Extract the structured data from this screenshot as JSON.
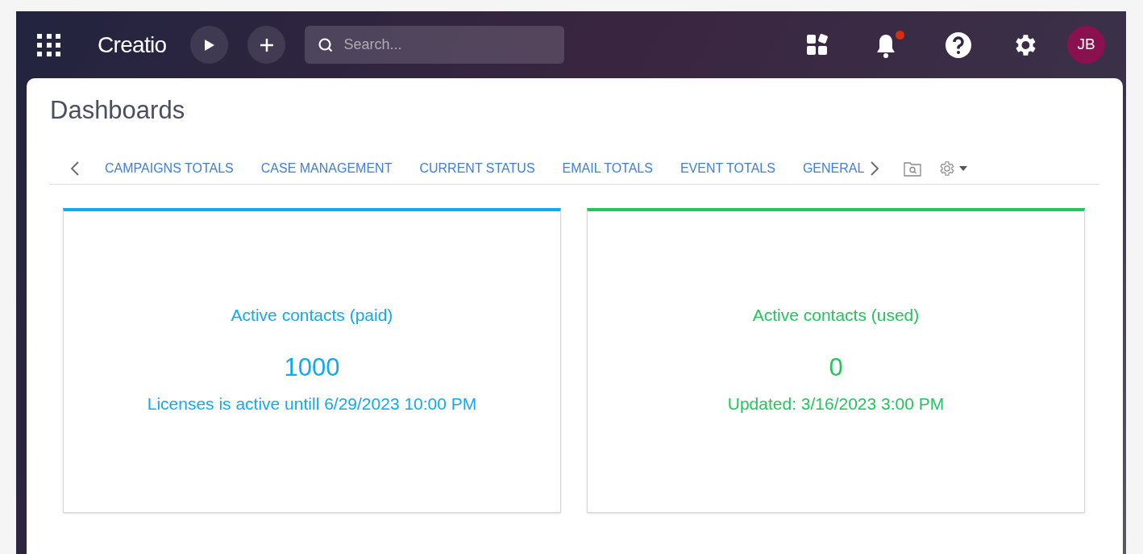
{
  "header": {
    "logo": "Creatio",
    "search": {
      "placeholder": "Search..."
    },
    "notifications": {
      "unread": true
    },
    "avatar": "JB"
  },
  "page": {
    "title": "Dashboards"
  },
  "tabs": [
    {
      "label": "CAMPAIGNS TOTALS",
      "selected": false
    },
    {
      "label": "CASE MANAGEMENT",
      "selected": false
    },
    {
      "label": "CURRENT STATUS",
      "selected": false
    },
    {
      "label": "EMAIL TOTALS",
      "selected": false
    },
    {
      "label": "EVENT TOTALS",
      "selected": false
    },
    {
      "label": "GENERAL",
      "selected": false
    }
  ],
  "widgets": [
    {
      "title": "Active contacts (paid)",
      "value": "1000",
      "note": "Licenses is active untill 6/29/2023 10:00 PM",
      "color": "#12a9f0"
    },
    {
      "title": "Active contacts (used)",
      "value": "0",
      "note": "Updated: 3/16/2023 3:00 PM",
      "color": "#22c55e"
    }
  ]
}
